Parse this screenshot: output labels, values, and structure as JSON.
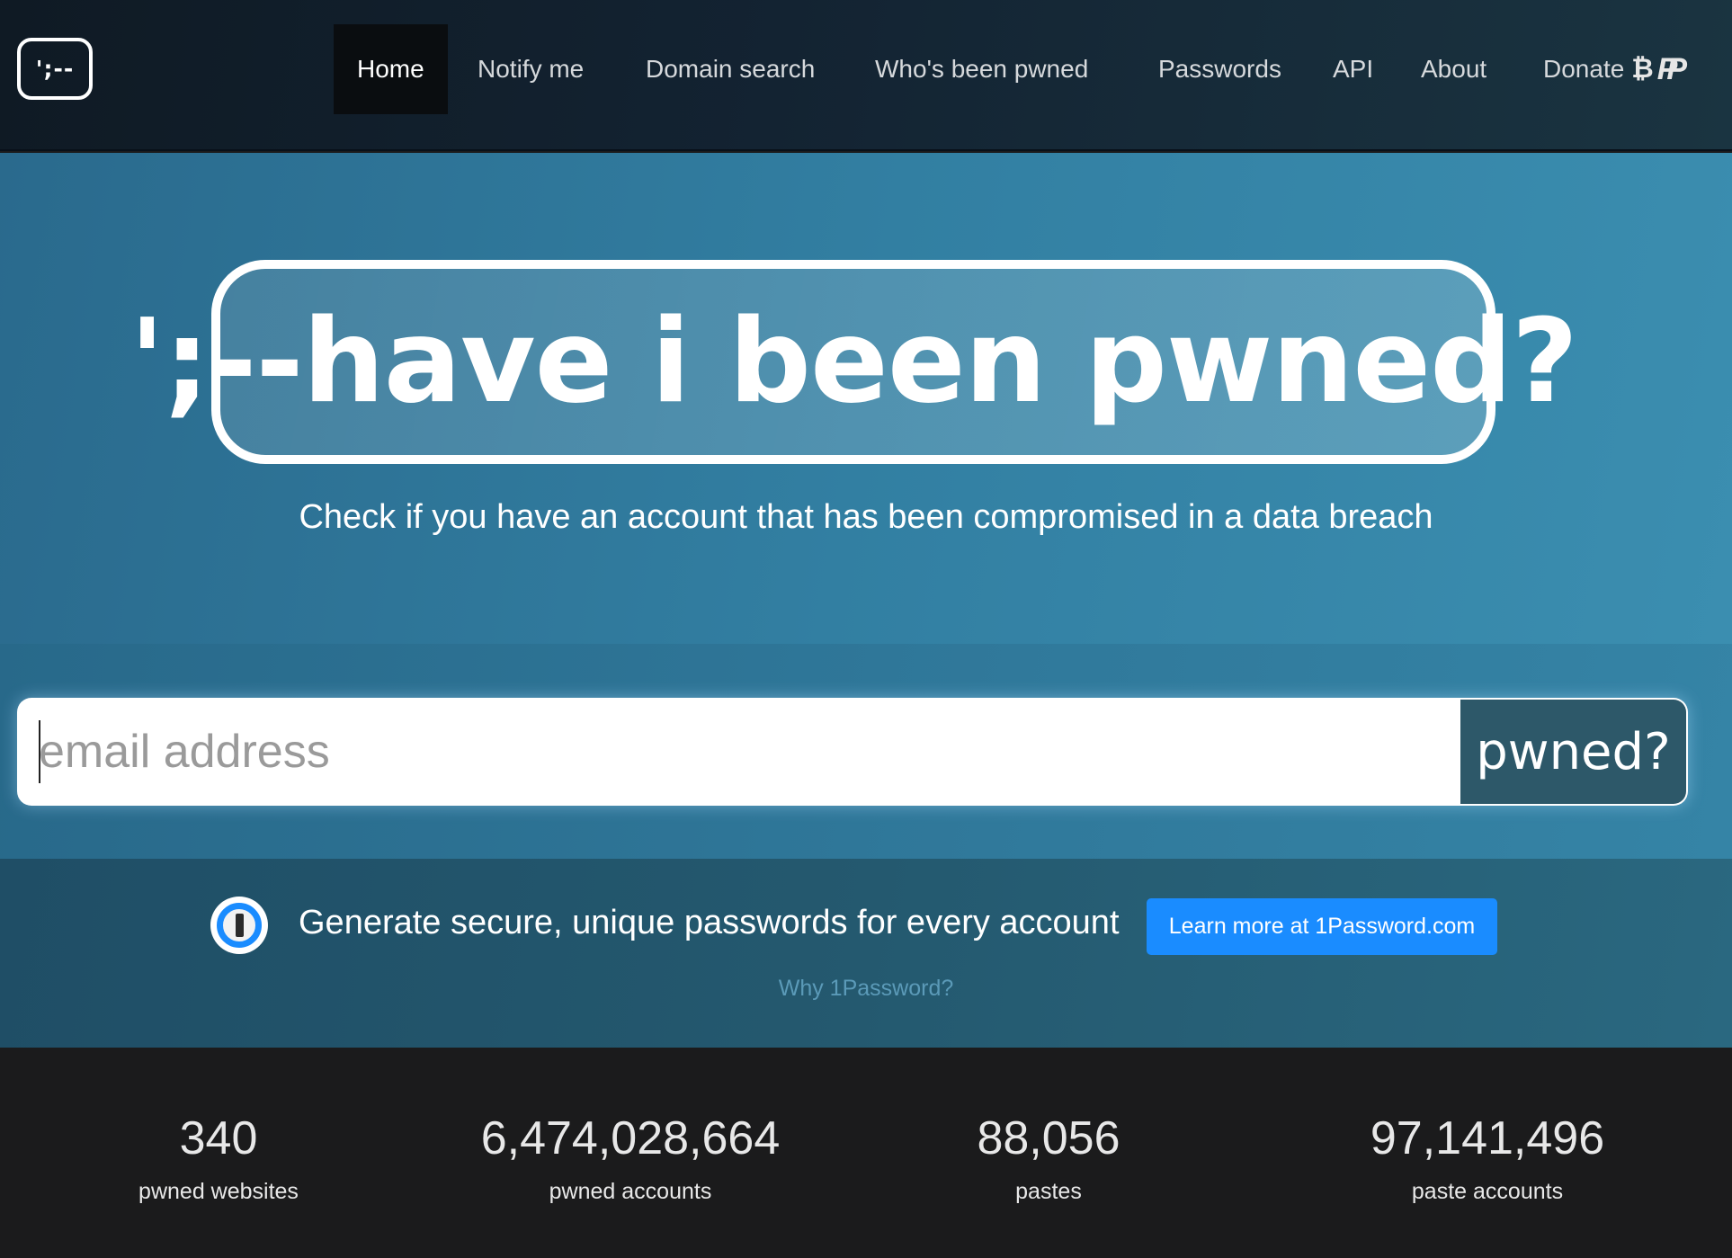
{
  "nav": {
    "logo_text": "';--",
    "items": [
      {
        "label": "Home",
        "active": true
      },
      {
        "label": "Notify me"
      },
      {
        "label": "Domain search"
      },
      {
        "label": "Who's been pwned"
      },
      {
        "label": "Passwords"
      },
      {
        "label": "API"
      },
      {
        "label": "About"
      },
      {
        "label": "Donate"
      }
    ],
    "donate_icons": {
      "bitcoin": "₿",
      "paypal": "PP"
    }
  },
  "hero": {
    "title": "';--have i been pwned?",
    "subtitle": "Check if you have an account that has been compromised in a data breach"
  },
  "search": {
    "placeholder": "email address",
    "value": "",
    "button_label": "pwned?"
  },
  "promo": {
    "icon": "1password-icon",
    "text": "Generate secure, unique passwords for every account",
    "button_label": "Learn more at 1Password.com",
    "link_label": "Why 1Password?",
    "accent_color": "#1a8cff"
  },
  "stats": [
    {
      "value": "340",
      "label": "pwned websites"
    },
    {
      "value": "6,474,028,664",
      "label": "pwned accounts"
    },
    {
      "value": "88,056",
      "label": "pastes"
    },
    {
      "value": "97,141,496",
      "label": "paste accounts"
    }
  ]
}
